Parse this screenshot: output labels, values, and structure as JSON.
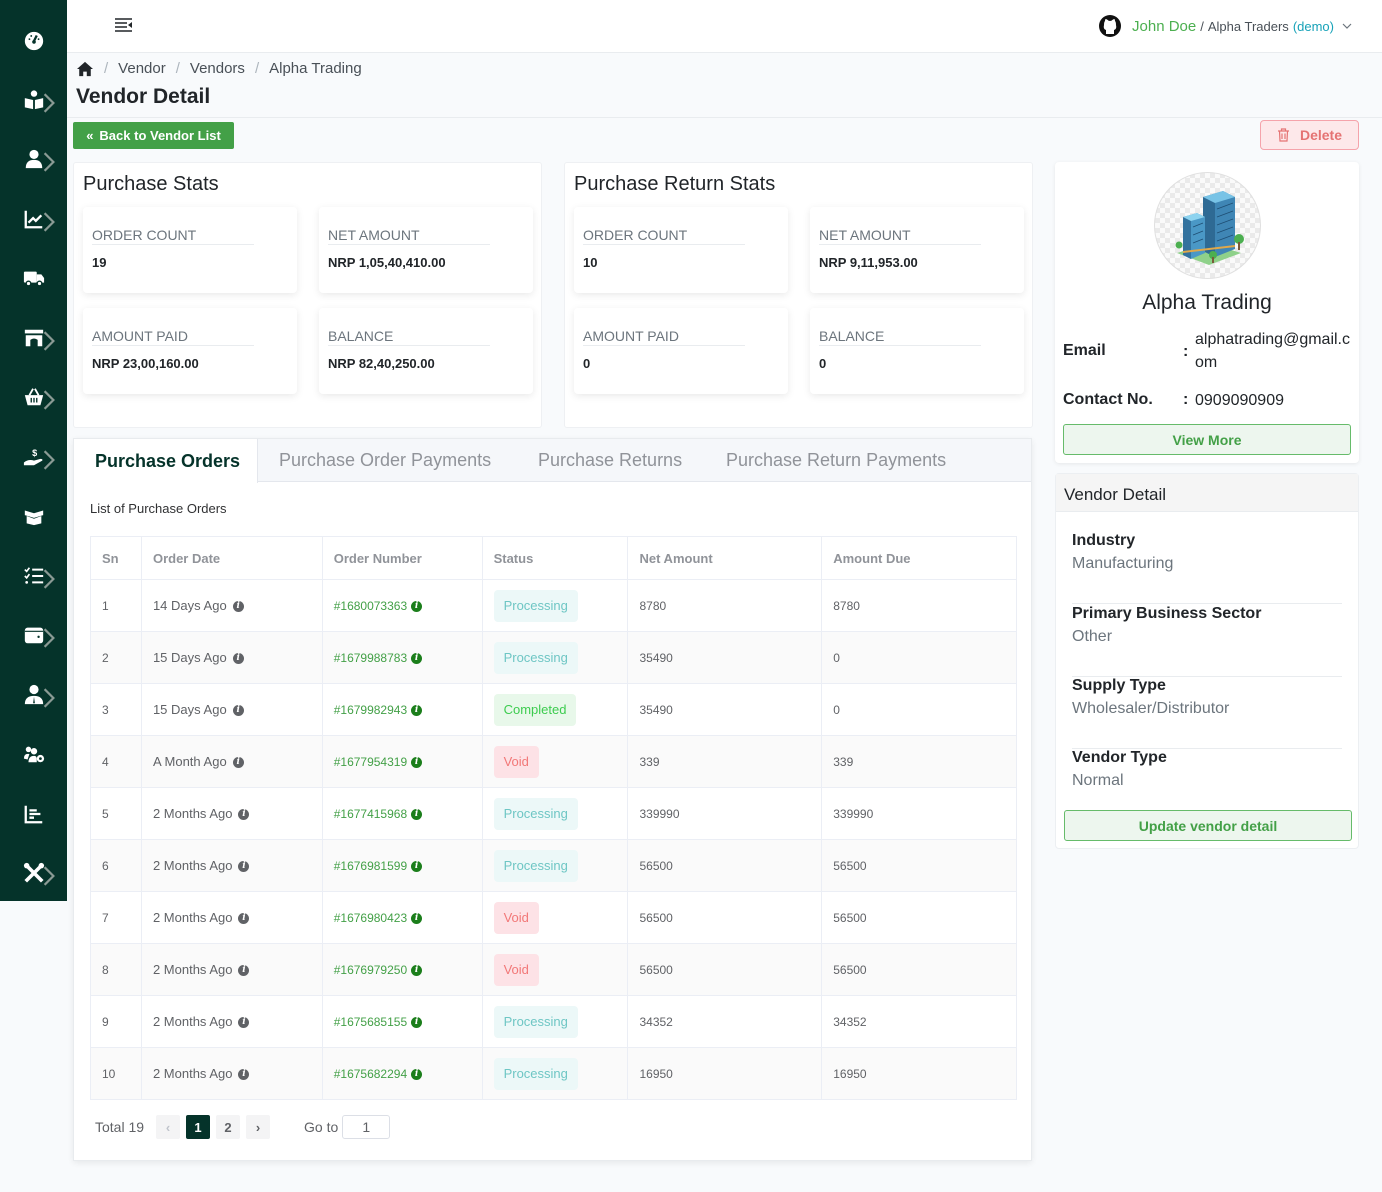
{
  "sidebar": {
    "items": [
      {
        "icon": "dashboard-icon"
      },
      {
        "icon": "reader-icon"
      },
      {
        "icon": "user-icon"
      },
      {
        "icon": "chart-line-icon"
      },
      {
        "icon": "truck-icon"
      },
      {
        "icon": "store-icon"
      },
      {
        "icon": "basket-icon"
      },
      {
        "icon": "hand-dollar-icon"
      },
      {
        "icon": "box-open-icon"
      },
      {
        "icon": "checklist-icon"
      },
      {
        "icon": "wallet-icon"
      },
      {
        "icon": "user-tie-icon"
      },
      {
        "icon": "users-cog-icon"
      },
      {
        "icon": "bar-chart-icon"
      },
      {
        "icon": "tools-icon"
      }
    ]
  },
  "topbar": {
    "user_name": "John Doe",
    "separator": "/",
    "org": "Alpha Traders",
    "org_tag": "(demo)"
  },
  "breadcrumb": [
    "Vendor",
    "Vendors",
    "Alpha Trading"
  ],
  "page_title": "Vendor Detail",
  "buttons": {
    "back": "Back to Vendor List",
    "delete": "Delete",
    "view_more": "View More",
    "update": "Update vendor detail"
  },
  "purchase_stats": {
    "title": "Purchase Stats",
    "cards": [
      {
        "label": "ORDER COUNT",
        "value": "19"
      },
      {
        "label": "NET AMOUNT",
        "value": "NRP 1,05,40,410.00"
      },
      {
        "label": "AMOUNT PAID",
        "value": "NRP 23,00,160.00"
      },
      {
        "label": "BALANCE",
        "value": "NRP 82,40,250.00"
      }
    ]
  },
  "return_stats": {
    "title": "Purchase Return Stats",
    "cards": [
      {
        "label": "ORDER COUNT",
        "value": "10"
      },
      {
        "label": "NET AMOUNT",
        "value": "NRP 9,11,953.00"
      },
      {
        "label": "AMOUNT PAID",
        "value": "0"
      },
      {
        "label": "BALANCE",
        "value": "0"
      }
    ]
  },
  "vendor": {
    "name": "Alpha Trading",
    "email_label": "Email",
    "email": "alphatrading@gmail.com",
    "contact_label": "Contact No.",
    "contact": "0909090909",
    "colon": ":"
  },
  "vendor_detail": {
    "title": "Vendor Detail",
    "rows": [
      {
        "key": "Industry",
        "value": "Manufacturing"
      },
      {
        "key": "Primary Business Sector",
        "value": "Other"
      },
      {
        "key": "Supply Type",
        "value": "Wholesaler/Distributor"
      },
      {
        "key": "Vendor Type",
        "value": "Normal"
      }
    ]
  },
  "tabs": [
    {
      "label": "Purchase Orders",
      "active": true
    },
    {
      "label": "Purchase Order Payments",
      "active": false
    },
    {
      "label": "Purchase Returns",
      "active": false
    },
    {
      "label": "Purchase Return Payments",
      "active": false
    }
  ],
  "orders": {
    "list_title": "List of Purchase Orders",
    "columns": [
      "Sn",
      "Order Date",
      "Order Number",
      "Status",
      "Net Amount",
      "Amount Due"
    ],
    "rows": [
      {
        "sn": "1",
        "date": "14 Days Ago",
        "number": "#1680073363",
        "status": "Processing",
        "net": "8780",
        "due": "8780"
      },
      {
        "sn": "2",
        "date": "15 Days Ago",
        "number": "#1679988783",
        "status": "Processing",
        "net": "35490",
        "due": "0"
      },
      {
        "sn": "3",
        "date": "15 Days Ago",
        "number": "#1679982943",
        "status": "Completed",
        "net": "35490",
        "due": "0"
      },
      {
        "sn": "4",
        "date": "A Month Ago",
        "number": "#1677954319",
        "status": "Void",
        "net": "339",
        "due": "339"
      },
      {
        "sn": "5",
        "date": "2 Months Ago",
        "number": "#1677415968",
        "status": "Processing",
        "net": "339990",
        "due": "339990"
      },
      {
        "sn": "6",
        "date": "2 Months Ago",
        "number": "#1676981599",
        "status": "Processing",
        "net": "56500",
        "due": "56500"
      },
      {
        "sn": "7",
        "date": "2 Months Ago",
        "number": "#1676980423",
        "status": "Void",
        "net": "56500",
        "due": "56500"
      },
      {
        "sn": "8",
        "date": "2 Months Ago",
        "number": "#1676979250",
        "status": "Void",
        "net": "56500",
        "due": "56500"
      },
      {
        "sn": "9",
        "date": "2 Months Ago",
        "number": "#1675685155",
        "status": "Processing",
        "net": "34352",
        "due": "34352"
      },
      {
        "sn": "10",
        "date": "2 Months Ago",
        "number": "#1675682294",
        "status": "Processing",
        "net": "16950",
        "due": "16950"
      }
    ]
  },
  "pagination": {
    "total_label": "Total 19",
    "pages": [
      "1",
      "2"
    ],
    "current": "1",
    "goto_label": "Go to",
    "goto_value": "1"
  },
  "colors": {
    "sidebar_bg": "#05332a",
    "accent_green": "#43a047",
    "delete_red": "#e57373"
  }
}
